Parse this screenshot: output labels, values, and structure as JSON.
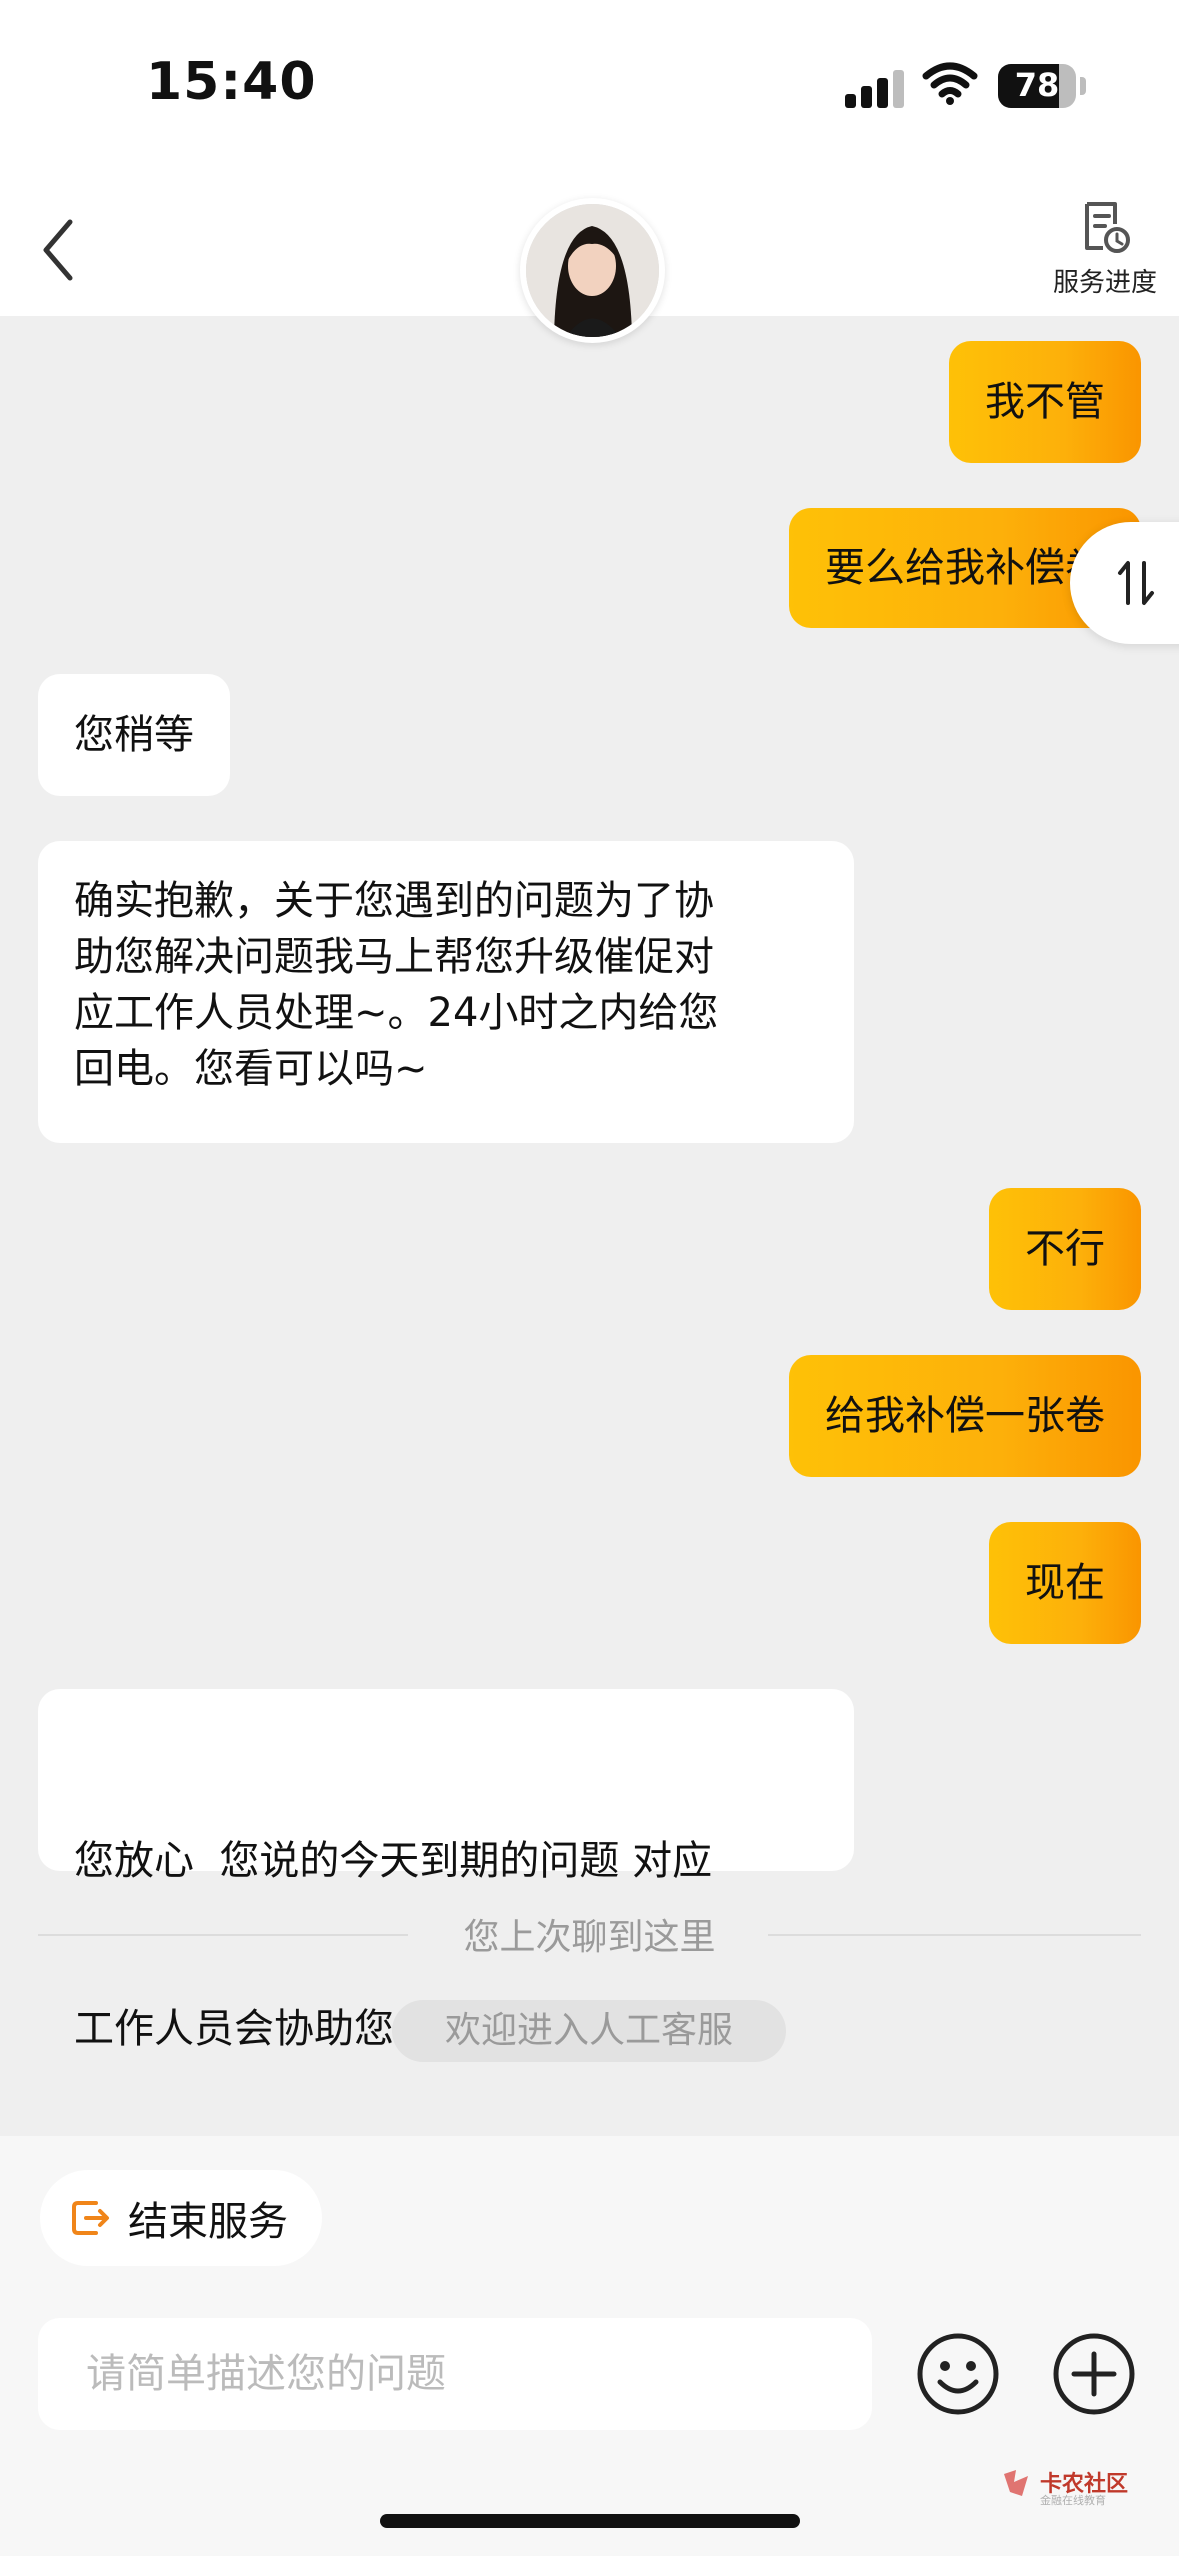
{
  "status_bar": {
    "time": "15:40",
    "battery": "78",
    "battery_level": 0.78
  },
  "header": {
    "progress_label": "服务进度"
  },
  "messages": [
    {
      "side": "out",
      "text": "我不管"
    },
    {
      "side": "out",
      "text": "要么给我补偿卷"
    },
    {
      "side": "in",
      "text": "您稍等"
    },
    {
      "side": "in",
      "lines": [
        "确实抱歉，关于您遇到的问题为了协",
        "助您解决问题我马上帮您升级催促对",
        "应工作人员处理~。24小时之内给您",
        "回电。您看可以吗~"
      ]
    },
    {
      "side": "out",
      "text": "不行"
    },
    {
      "side": "out",
      "text": "给我补偿一张卷"
    },
    {
      "side": "out",
      "text": "现在"
    },
    {
      "side": "in",
      "lines": [
        "您放心  您说的今天到期的问题 对应",
        "工作人员会协助您处理的"
      ]
    }
  ],
  "divider_text": "您上次聊到这里",
  "welcome_text": "欢迎进入人工客服",
  "end_service_label": "结束服务",
  "input_placeholder": "请简单描述您的问题",
  "watermark": {
    "main": "卡农社区",
    "sub": "金融在线教育"
  },
  "colors": {
    "accent": "#fec107",
    "accent_end": "#fa9500",
    "end_icon": "#f08519"
  }
}
